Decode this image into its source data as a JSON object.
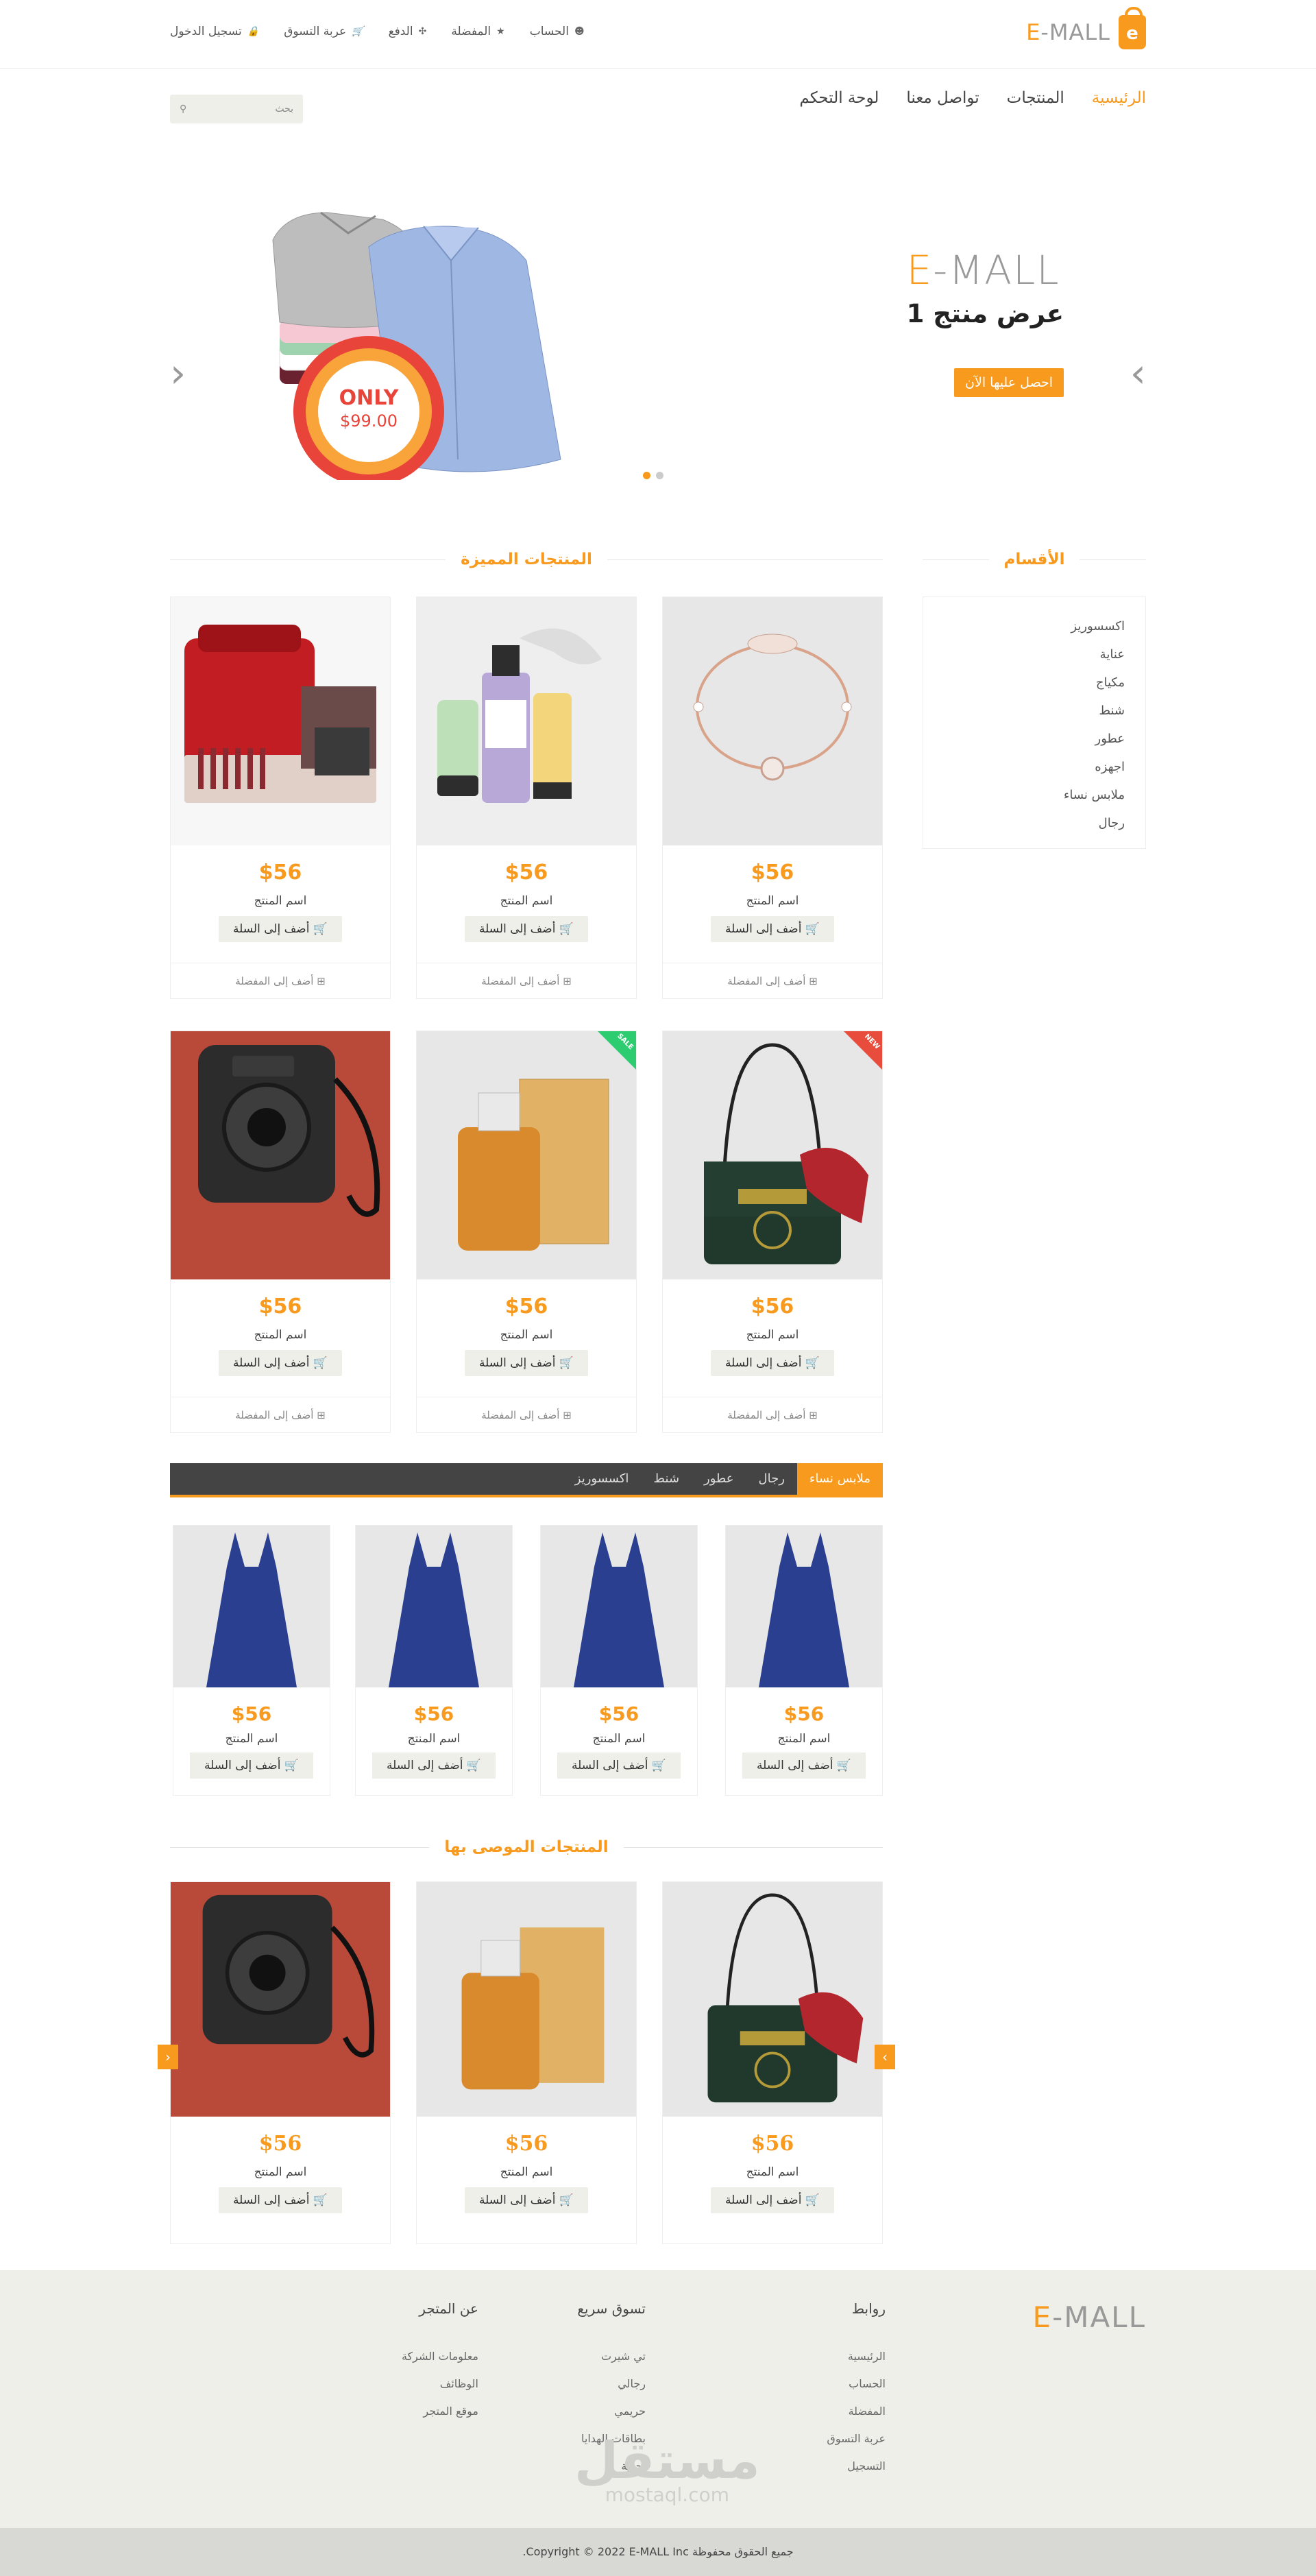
{
  "brand": {
    "logo_letter": "e",
    "logo_e": "E",
    "logo_rest": "-MALL"
  },
  "topbar": {
    "links": [
      {
        "label": "الحساب",
        "icon": "user-icon"
      },
      {
        "label": "المفضلة",
        "icon": "star-icon"
      },
      {
        "label": "الدفع",
        "icon": "crosshair-icon"
      },
      {
        "label": "عربة التسوق",
        "icon": "cart-icon"
      },
      {
        "label": "تسجيل الدخول",
        "icon": "lock-icon"
      }
    ]
  },
  "nav": {
    "items": [
      "الرئيسية",
      "المنتجات",
      "تواصل معنا",
      "لوحة التحكم"
    ],
    "search_placeholder": "بحث"
  },
  "slider": {
    "logo_e": "E",
    "logo_rest": "-MALL",
    "title": "عرض منتج 1",
    "button": "احصل عليها الآن",
    "badge_top": "ONLY",
    "badge_price": "$99.00",
    "prev": "‹",
    "next": "›"
  },
  "categories": {
    "title": "الأقسام",
    "items": [
      "اكسسوريز",
      "عناية",
      "مكياج",
      "شنط",
      "عطور",
      "اجهزه",
      "ملابس نساء",
      "رجال"
    ]
  },
  "featured": {
    "title": "المنتجات المميزة",
    "products": [
      {
        "price": "$56",
        "name": "اسم المنتج",
        "cart": "أضف إلى السلة",
        "fav": "أضف إلى المفضلة",
        "image": "bracelet"
      },
      {
        "price": "$56",
        "name": "اسم المنتج",
        "cart": "أضف إلى السلة",
        "fav": "أضف إلى المفضلة",
        "image": "clinique"
      },
      {
        "price": "$56",
        "name": "اسم المنتج",
        "cart": "أضف إلى السلة",
        "fav": "أضف إلى المفضلة",
        "image": "makeup-case"
      },
      {
        "price": "$56",
        "name": "اسم المنتج",
        "cart": "أضف إلى السلة",
        "fav": "أضف إلى المفضلة",
        "image": "handbag",
        "badge": "NEW",
        "badge_color": "#e74c3c"
      },
      {
        "price": "$56",
        "name": "اسم المنتج",
        "cart": "أضف إلى السلة",
        "fav": "أضف إلى المفضلة",
        "image": "perfume",
        "badge": "SALE",
        "badge_color": "#2ecc71"
      },
      {
        "price": "$56",
        "name": "اسم المنتج",
        "cart": "أضف إلى السلة",
        "fav": "أضف إلى المفضلة",
        "image": "camera"
      }
    ]
  },
  "tabs": {
    "items": [
      "ملابس نساء",
      "رجال",
      "عطور",
      "شنط",
      "اكسسوريز"
    ]
  },
  "dresses": [
    {
      "price": "$56",
      "name": "اسم المنتج",
      "cart": "أضف إلى السلة"
    },
    {
      "price": "$56",
      "name": "اسم المنتج",
      "cart": "أضف إلى السلة"
    },
    {
      "price": "$56",
      "name": "اسم المنتج",
      "cart": "أضف إلى السلة"
    },
    {
      "price": "$56",
      "name": "اسم المنتج",
      "cart": "أضف إلى السلة"
    }
  ],
  "recommended": {
    "title": "المنتجات الموصى بها",
    "products": [
      {
        "price": "$56",
        "name": "اسم المنتج",
        "cart": "أضف إلى السلة",
        "image": "handbag"
      },
      {
        "price": "$56",
        "name": "اسم المنتج",
        "cart": "أضف إلى السلة",
        "image": "perfume"
      },
      {
        "price": "$56",
        "name": "اسم المنتج",
        "cart": "أضف إلى السلة",
        "image": "camera"
      }
    ]
  },
  "footer": {
    "logo_e": "E",
    "logo_rest": "-MALL",
    "columns": [
      {
        "title": "روابط",
        "items": [
          "الرئيسية",
          "الحساب",
          "المفضلة",
          "عربة التسوق",
          "التسجيل"
        ]
      },
      {
        "title": "تسوق سريع",
        "items": [
          "تي شيرت",
          "رجالي",
          "حريمي",
          "بطاقات الهدايا",
          "أحذية"
        ]
      },
      {
        "title": "عن المتجر",
        "items": [
          "معلومات الشركة",
          "الوظائف",
          "موقع المتجر"
        ]
      }
    ],
    "watermark_ar": "مستقل",
    "watermark_en": "mostaql.com",
    "copyright": "جميع الحقوق محفوظة Copyright © 2022 E-MALL Inc."
  },
  "colors": {
    "accent": "#f89a1e",
    "dark": "#444444",
    "footer_bg": "#efefea"
  }
}
